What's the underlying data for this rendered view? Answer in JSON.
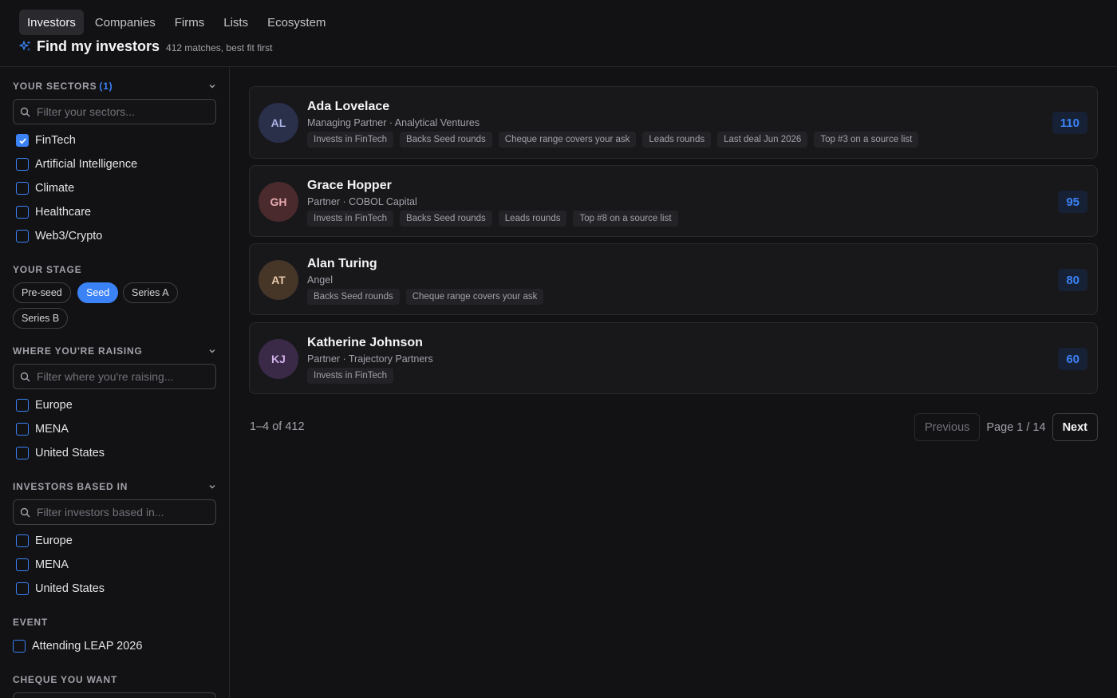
{
  "nav": {
    "tabs": [
      {
        "label": "Investors",
        "active": true
      },
      {
        "label": "Companies"
      },
      {
        "label": "Firms"
      },
      {
        "label": "Lists"
      },
      {
        "label": "Ecosystem"
      }
    ]
  },
  "header": {
    "title": "Find my investors",
    "subtitle": "412 matches, best fit first"
  },
  "colors": {
    "accent": "#3b82f6",
    "background": "#121214",
    "card": "#18181b"
  },
  "sidebar": {
    "sectors": {
      "label": "YOUR SECTORS",
      "count": "(1)",
      "placeholder": "Filter your sectors...",
      "options": [
        {
          "label": "FinTech",
          "checked": true
        },
        {
          "label": "Artificial Intelligence",
          "checked": false
        },
        {
          "label": "Climate",
          "checked": false
        },
        {
          "label": "Healthcare",
          "checked": false
        },
        {
          "label": "Web3/Crypto",
          "checked": false
        }
      ]
    },
    "stage": {
      "label": "YOUR STAGE",
      "options": [
        {
          "label": "Pre-seed",
          "active": false
        },
        {
          "label": "Seed",
          "active": true
        },
        {
          "label": "Series A",
          "active": false
        },
        {
          "label": "Series B",
          "active": false
        }
      ]
    },
    "raising": {
      "label": "WHERE YOU'RE RAISING",
      "placeholder": "Filter where you're raising...",
      "options": [
        {
          "label": "Europe",
          "checked": false
        },
        {
          "label": "MENA",
          "checked": false
        },
        {
          "label": "United States",
          "checked": false
        }
      ]
    },
    "based": {
      "label": "INVESTORS BASED IN",
      "placeholder": "Filter investors based in...",
      "options": [
        {
          "label": "Europe",
          "checked": false
        },
        {
          "label": "MENA",
          "checked": false
        },
        {
          "label": "United States",
          "checked": false
        }
      ]
    },
    "event": {
      "label": "EVENT",
      "options": [
        {
          "label": "Attending LEAP 2026",
          "checked": false
        }
      ]
    },
    "cheque": {
      "label": "CHEQUE YOU WANT"
    }
  },
  "investors": [
    {
      "initials": "AL",
      "name": "Ada Lovelace",
      "role": "Managing Partner · Analytical Ventures",
      "score": "110",
      "avatar_bg": "#2a2f4a",
      "avatar_fg": "#aab4e8",
      "tags": [
        "Invests in FinTech",
        "Backs Seed rounds",
        "Cheque range covers your ask",
        "Leads rounds",
        "Last deal Jun 2026",
        "Top #3 on a source list"
      ]
    },
    {
      "initials": "GH",
      "name": "Grace Hopper",
      "role": "Partner · COBOL Capital",
      "score": "95",
      "avatar_bg": "#4a2a2c",
      "avatar_fg": "#e8aab0",
      "tags": [
        "Invests in FinTech",
        "Backs Seed rounds",
        "Leads rounds",
        "Top #8 on a source list"
      ]
    },
    {
      "initials": "AT",
      "name": "Alan Turing",
      "role": "Angel",
      "score": "80",
      "avatar_bg": "#463628",
      "avatar_fg": "#e8c8a8",
      "tags": [
        "Backs Seed rounds",
        "Cheque range covers your ask"
      ]
    },
    {
      "initials": "KJ",
      "name": "Katherine Johnson",
      "role": "Partner · Trajectory Partners",
      "score": "60",
      "avatar_bg": "#3a2a48",
      "avatar_fg": "#d0b0e8",
      "tags": [
        "Invests in FinTech"
      ]
    }
  ],
  "pagination": {
    "range": "1–4 of 412",
    "prev": "Previous",
    "page": "Page 1 / 14",
    "next": "Next"
  }
}
